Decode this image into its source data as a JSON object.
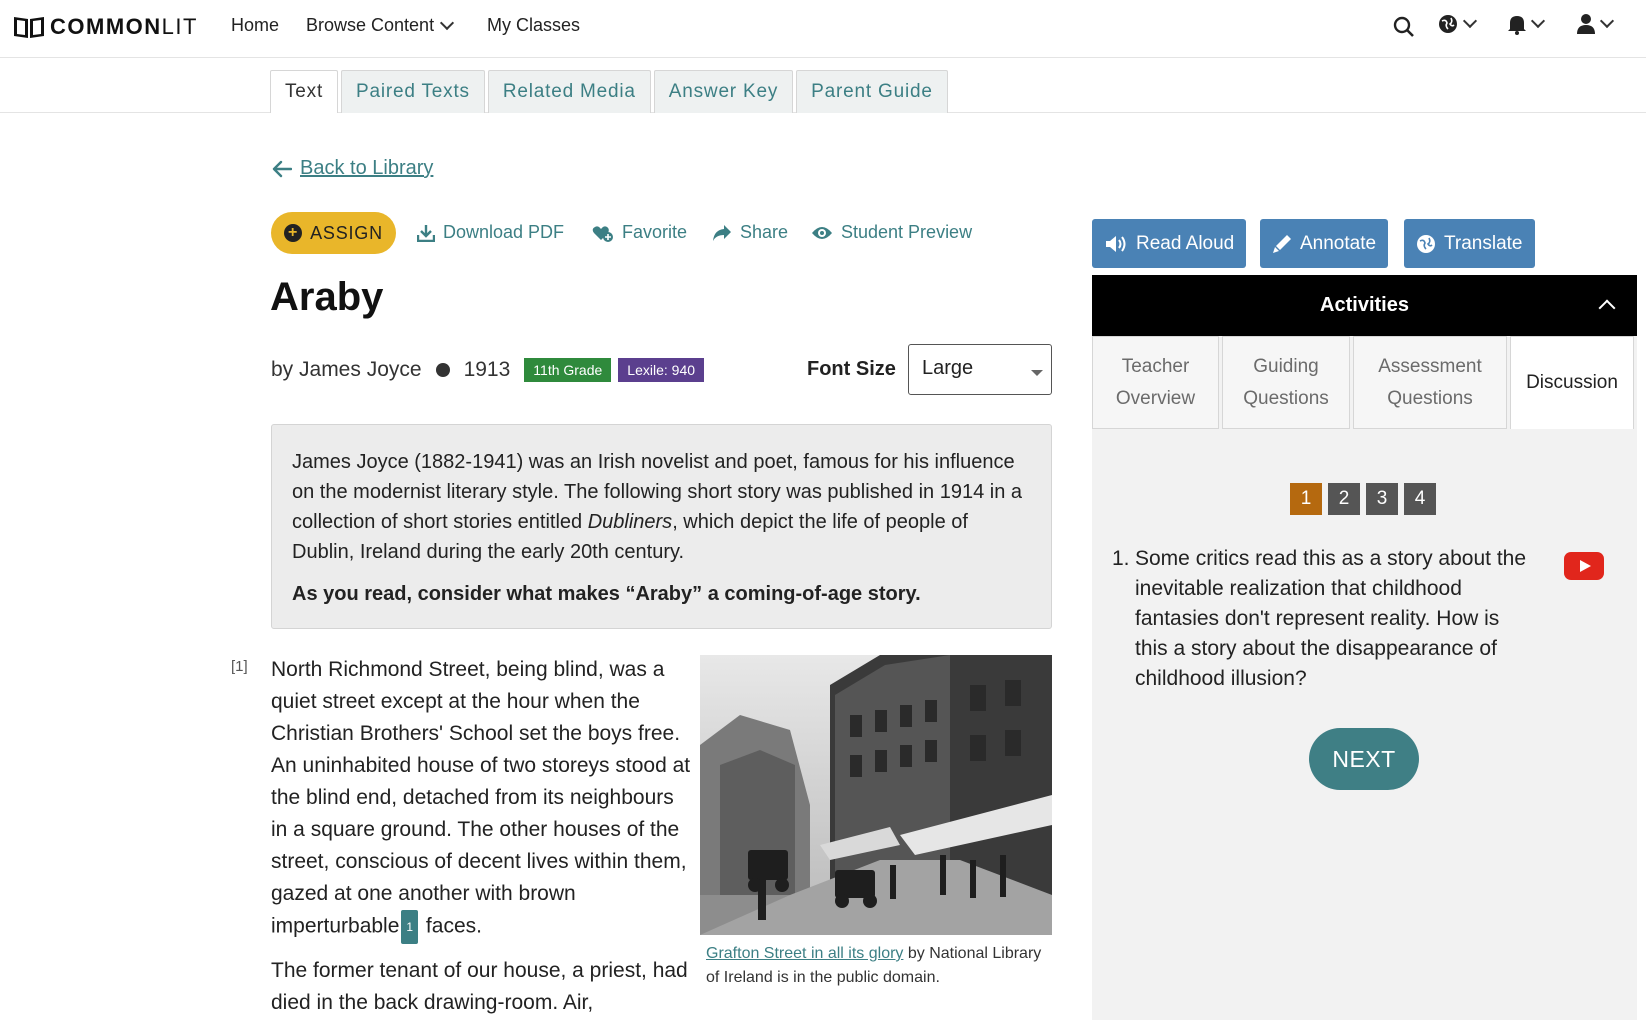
{
  "nav": {
    "logo_bold": "COMMON",
    "logo_light": "LIT",
    "home": "Home",
    "browse": "Browse Content",
    "classes": "My Classes"
  },
  "tabs": [
    {
      "label": "Text"
    },
    {
      "label": "Paired Texts"
    },
    {
      "label": "Related Media"
    },
    {
      "label": "Answer Key"
    },
    {
      "label": "Parent Guide"
    }
  ],
  "back_label": "Back to Library",
  "actions": {
    "assign": "ASSIGN",
    "download": "Download PDF",
    "favorite": "Favorite",
    "share": "Share",
    "preview": "Student Preview"
  },
  "text": {
    "title": "Araby",
    "author": "by James Joyce",
    "year": "1913",
    "grade": "11th Grade",
    "lexile": "Lexile: 940"
  },
  "font_size": {
    "label": "Font Size",
    "value": "Large"
  },
  "intro": {
    "part1": "James Joyce (1882-1941) was an Irish novelist and poet, famous for his influence on the modernist literary style. The following short story was published in 1914 in a collection of short stories entitled ",
    "italic": "Dubliners",
    "part2": ", which depict the life of people of Dublin, Ireland during the early 20th century.",
    "prompt": "As you read, consider what makes “Araby” a coming-of-age story."
  },
  "paragraph1": {
    "number": "[1]",
    "text": "North Richmond Street, being blind, was a quiet street except at the hour when the Christian Brothers' School set the boys free. An uninhabited house of two storeys stood at the blind end, detached from its neighbours in a square ground. The other houses of the street, conscious of decent lives within them, gazed at one another with brown imperturbable",
    "note": "1",
    "tail": " faces."
  },
  "paragraph2": {
    "text": "The former tenant of our house, a priest, had died in the back drawing-room. Air,"
  },
  "image_caption": {
    "link": "Grafton Street in all its glory",
    "rest": " by National Library of Ireland is in the public domain."
  },
  "tools": {
    "read_aloud": "Read Aloud",
    "annotate": "Annotate",
    "translate": "Translate"
  },
  "activities": {
    "header": "Activities",
    "tabs": [
      {
        "line1": "Teacher",
        "line2": "Overview"
      },
      {
        "line1": "Guiding",
        "line2": "Questions"
      },
      {
        "line1": "Assessment",
        "line2": "Questions"
      },
      {
        "line1": "Discussion",
        "line2": ""
      }
    ],
    "pages": [
      "1",
      "2",
      "3",
      "4"
    ],
    "question_number": "1.",
    "question": "Some critics read this as a story about the inevitable realization that childhood fantasies don't represent reality. How is this a story about the disappearance of childhood illusion?",
    "next": "NEXT"
  },
  "colors": {
    "accent": "#3c7f84",
    "assign": "#e9b62a",
    "tool": "#4a82b5",
    "active_page": "#b5690f"
  }
}
